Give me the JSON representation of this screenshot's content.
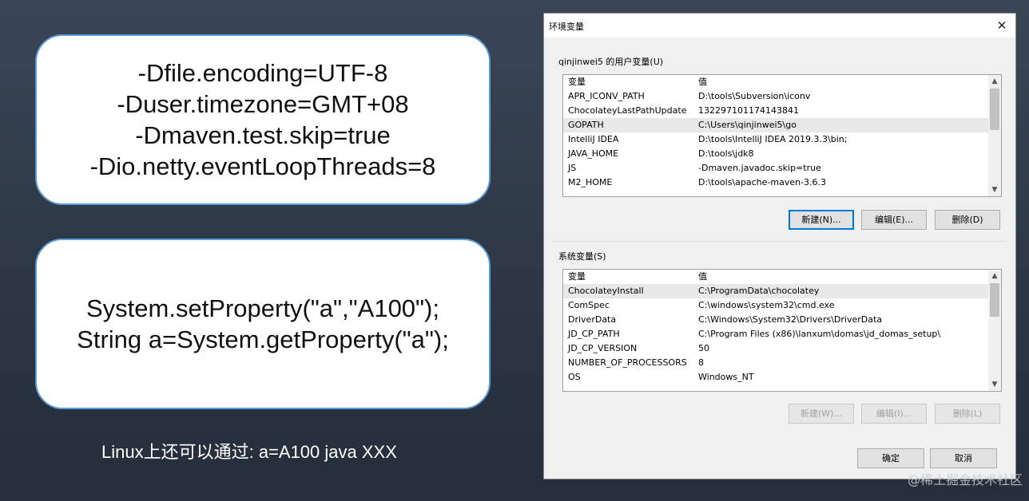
{
  "slide": {
    "card1_lines": [
      "-Dfile.encoding=UTF-8",
      "-Duser.timezone=GMT+08",
      "-Dmaven.test.skip=true",
      "-Dio.netty.eventLoopThreads=8"
    ],
    "card2_lines": [
      "System.setProperty(\"a\",\"A100\");",
      "String a=System.getProperty(\"a\");"
    ],
    "caption": "Linux上还可以通过: a=A100 java XXX",
    "watermark": "@稀土掘金技术社区"
  },
  "dialog": {
    "title": "环境变量",
    "close_glyph": "✕",
    "user_vars": {
      "label": "qinjinwei5 的用户变量(U)",
      "col_name": "变量",
      "col_value": "值",
      "rows": [
        {
          "name": "APR_ICONV_PATH",
          "value": "D:\\tools\\Subversion\\iconv"
        },
        {
          "name": "ChocolateyLastPathUpdate",
          "value": "132297101174143841"
        },
        {
          "name": "GOPATH",
          "value": "C:\\Users\\qinjinwei5\\go"
        },
        {
          "name": "IntelliJ IDEA",
          "value": "D:\\tools\\IntelliJ IDEA 2019.3.3\\bin;"
        },
        {
          "name": "JAVA_HOME",
          "value": "D:\\tools\\jdk8"
        },
        {
          "name": "JS",
          "value": "-Dmaven.javadoc.skip=true"
        },
        {
          "name": "M2_HOME",
          "value": "D:\\tools\\apache-maven-3.6.3"
        }
      ],
      "selected_index": 2,
      "buttons": {
        "new": "新建(N)...",
        "edit": "编辑(E)...",
        "delete": "删除(D)"
      }
    },
    "system_vars": {
      "label": "系统变量(S)",
      "col_name": "变量",
      "col_value": "值",
      "rows": [
        {
          "name": "ChocolateyInstall",
          "value": "C:\\ProgramData\\chocolatey"
        },
        {
          "name": "ComSpec",
          "value": "C:\\windows\\system32\\cmd.exe"
        },
        {
          "name": "DriverData",
          "value": "C:\\Windows\\System32\\Drivers\\DriverData"
        },
        {
          "name": "JD_CP_PATH",
          "value": "C:\\Program Files (x86)\\lanxum\\domas\\jd_domas_setup\\"
        },
        {
          "name": "JD_CP_VERSION",
          "value": "50"
        },
        {
          "name": "NUMBER_OF_PROCESSORS",
          "value": "8"
        },
        {
          "name": "OS",
          "value": "Windows_NT"
        }
      ],
      "selected_index": 0,
      "buttons": {
        "new": "新建(W)...",
        "edit": "编辑(I)...",
        "delete": "删除(L)"
      }
    },
    "ok": "确定",
    "cancel": "取消"
  }
}
